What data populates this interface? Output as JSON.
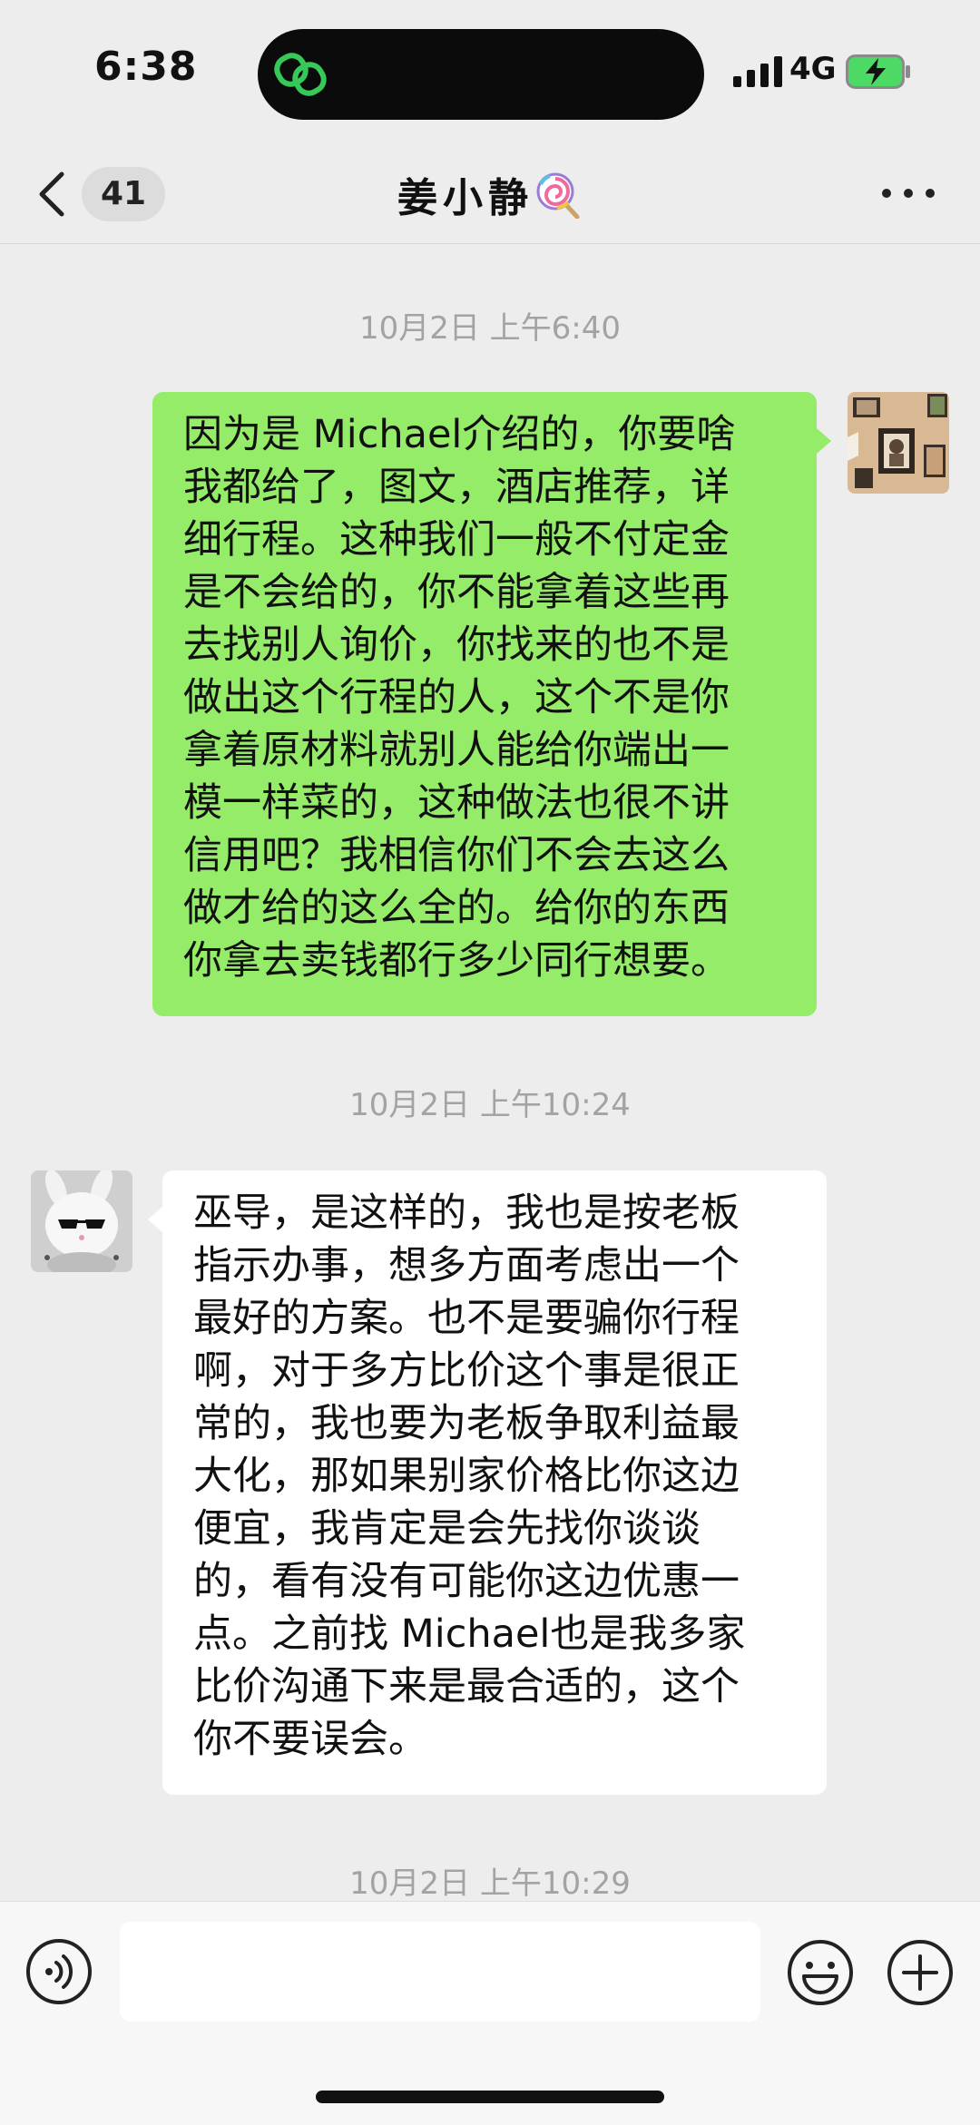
{
  "status_bar": {
    "time": "6:38",
    "network": "4G"
  },
  "nav": {
    "unread_count": "41",
    "contact_name": "姜小静"
  },
  "messages": [
    {
      "type": "timestamp",
      "text": "10月2日 上午6:40"
    },
    {
      "type": "message",
      "sender": "me",
      "lines": [
        "因为是 Michael介绍的，你要啥",
        "我都给了，图文，酒店推荐，详",
        "细行程。这种我们一般不付定金",
        "是不会给的，你不能拿着这些再",
        "去找别人询价，你找来的也不是",
        "做出这个行程的人，这个不是你",
        "拿着原材料就别人能给你端出一",
        "模一样菜的，这种做法也很不讲",
        "信用吧？我相信你们不会去这么",
        "做才给的这么全的。给你的东西",
        "你拿去卖钱都行多少同行想要。"
      ]
    },
    {
      "type": "timestamp",
      "text": "10月2日 上午10:24"
    },
    {
      "type": "message",
      "sender": "other",
      "lines": [
        "巫导，是这样的，我也是按老板",
        "指示办事，想多方面考虑出一个",
        "最好的方案。也不是要骗你行程",
        "啊，对于多方比价这个事是很正",
        "常的，我也要为老板争取利益最",
        "大化，那如果别家价格比你这边",
        "便宜，我肯定是会先找你谈谈",
        "的，看有没有可能你这边优惠一",
        "点。之前找 Michael也是我多家",
        "比价沟通下来是最合适的，这个",
        "你不要误会。"
      ]
    },
    {
      "type": "timestamp",
      "text": "10月2日 上午10:29"
    }
  ],
  "input": {
    "value": ""
  },
  "colors": {
    "my_bubble": "#95ec69",
    "their_bubble": "#ffffff",
    "background": "#ededed",
    "timestamp": "#a3a3a3"
  },
  "icons": {
    "back": "chevron-left-icon",
    "more": "more-dots-icon",
    "voice": "voice-icon",
    "emoji": "emoji-icon",
    "plus": "plus-icon",
    "title_emoji": "lollipop-icon"
  }
}
